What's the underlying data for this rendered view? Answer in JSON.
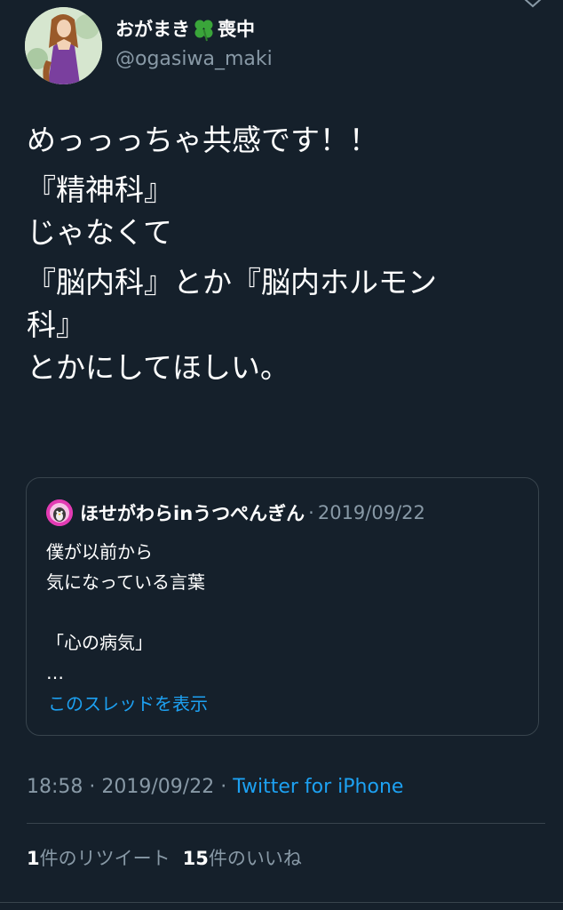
{
  "user": {
    "display_name_prefix": "おがまき",
    "display_name_suffix": "喪中",
    "handle": "@ogasiwa_maki"
  },
  "tweet": {
    "paragraphs": [
      "めっっっちゃ共感です！！",
      "『精神科』\nじゃなくて",
      "『脳内科』とか『脳内ホルモン\n科』\nとかにしてほしい。"
    ]
  },
  "quote": {
    "author": "ほせがわらinうつぺんぎん",
    "separator": "·",
    "date": "2019/09/22",
    "text": "僕が以前から\n気になっている言葉\n\n「心の病気」\n…",
    "thread_link": "このスレッドを表示"
  },
  "meta": {
    "time": "18:58",
    "separator": " · ",
    "date": "2019/09/22",
    "separator2": " · ",
    "source": "Twitter for iPhone"
  },
  "stats": {
    "retweet_count": "1",
    "retweet_label": "件のリツイート",
    "like_count": "15",
    "like_label": "件のいいね"
  },
  "colors": {
    "background": "#15202b",
    "text": "#ffffff",
    "secondary": "#8899a6",
    "accent": "#1da1f2",
    "border": "#38444d"
  },
  "icons": {
    "clover": "four-leaf-clover-emoji",
    "more": "chevron-down-icon"
  }
}
